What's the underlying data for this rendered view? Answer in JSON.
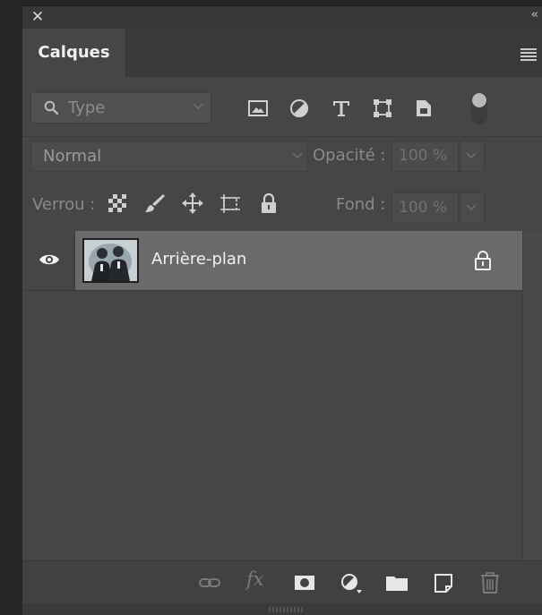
{
  "panel": {
    "close_glyph": "✕",
    "collapse_glyph": "‹‹",
    "tab_label": "Calques",
    "menu_icon": "hamburger-menu-icon"
  },
  "filter": {
    "kind_label": "Type",
    "icons": [
      "search-icon",
      "image-filter-icon",
      "adjustment-filter-icon",
      "type-filter-icon",
      "shape-filter-icon",
      "smart-object-filter-icon"
    ],
    "toggle_state": "off"
  },
  "blend": {
    "mode": "Normal",
    "opacity_label": "Opacité :",
    "opacity_value": "100 %"
  },
  "locks": {
    "label": "Verrou :",
    "icons": [
      "lock-transparent-pixels-icon",
      "lock-image-pixels-icon",
      "lock-position-icon",
      "lock-artboard-icon",
      "lock-all-icon"
    ],
    "fill_label": "Fond :",
    "fill_value": "100 %"
  },
  "layers": [
    {
      "name": "Arrière-plan",
      "visible": true,
      "locked": true
    }
  ],
  "bottom": {
    "fx_label": "fx",
    "icons": [
      "link-layers-icon",
      "fx-icon",
      "layer-mask-icon",
      "adjustment-layer-icon",
      "group-folder-icon",
      "new-layer-icon",
      "trash-icon"
    ]
  },
  "colors": {
    "panel_bg": "#464646",
    "selected_row": "#6a6a6a",
    "text_light": "#f0f0f0",
    "text_dim": "#8a8a8a"
  }
}
